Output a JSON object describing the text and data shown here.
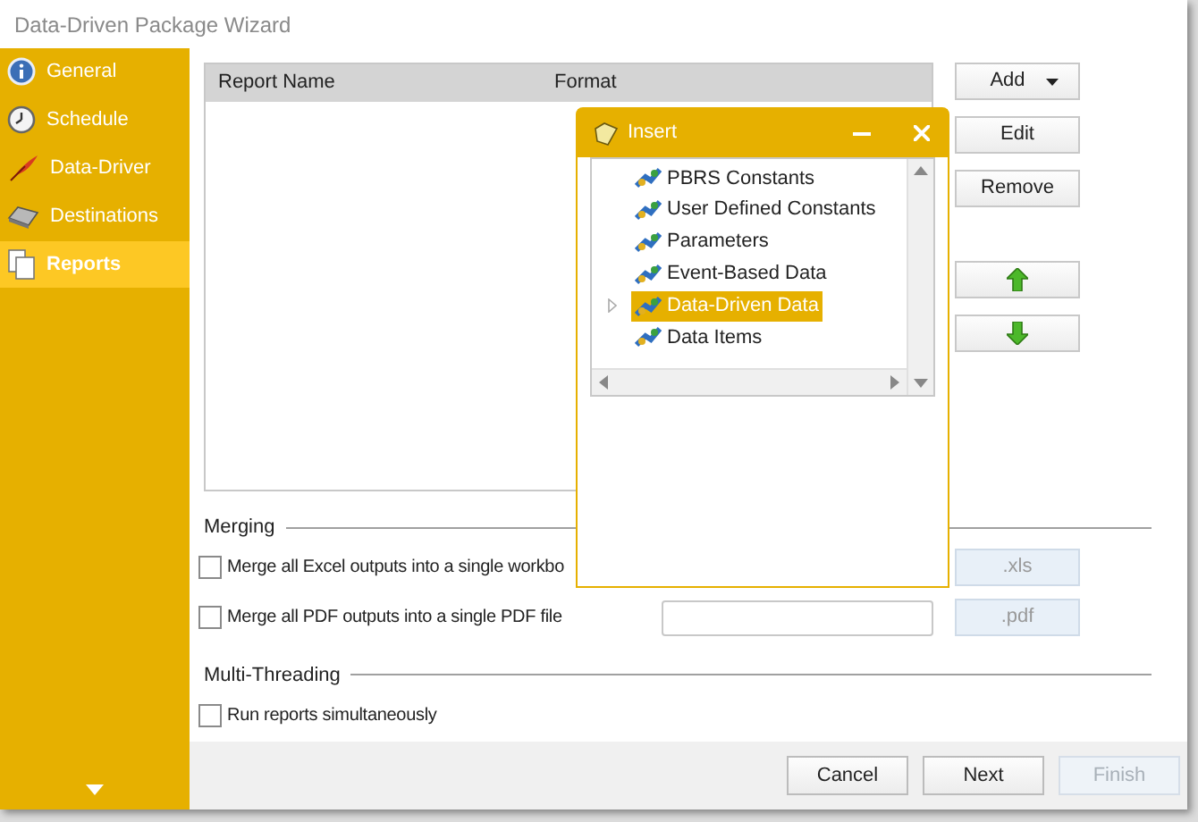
{
  "window": {
    "title": "Data-Driven Package Wizard"
  },
  "sidebar": {
    "items": [
      {
        "label": "General",
        "kind": "info",
        "selected": false
      },
      {
        "label": "Schedule",
        "kind": "clock",
        "selected": false
      },
      {
        "label": "Data-Driver",
        "kind": "feather",
        "selected": false
      },
      {
        "label": "Destinations",
        "kind": "drive",
        "selected": false
      },
      {
        "label": "Reports",
        "kind": "pages",
        "selected": true
      }
    ]
  },
  "reports_table": {
    "columns": [
      "Report Name",
      "Format"
    ]
  },
  "side_buttons": [
    {
      "kind": "dropdown",
      "label": "Add"
    },
    {
      "kind": "text",
      "label": "Edit"
    },
    {
      "kind": "text",
      "label": "Remove"
    },
    {
      "kind": "up"
    },
    {
      "kind": "down"
    }
  ],
  "merging": {
    "title": "Merging",
    "options": [
      {
        "label": "Merge all Excel outputs into a single workbo",
        "checked": false,
        "field_visible": false,
        "extension": ".xls"
      },
      {
        "label": "Merge all PDF outputs into a single PDF file",
        "checked": false,
        "field_visible": true,
        "extension": ".pdf"
      }
    ]
  },
  "multi_threading": {
    "title": "Multi-Threading",
    "options": [
      {
        "label": "Run reports simultaneously",
        "checked": false
      }
    ]
  },
  "footer": {
    "buttons": [
      {
        "label": "Cancel",
        "disabled": false
      },
      {
        "label": "Next",
        "disabled": false
      },
      {
        "label": "Finish",
        "disabled": true
      }
    ]
  },
  "insert_dialog": {
    "title": "Insert",
    "items": [
      {
        "label": "PBRS Constants",
        "selected": false,
        "expandable": false
      },
      {
        "label": "User Defined Constants",
        "selected": false,
        "expandable": false
      },
      {
        "label": "Parameters",
        "selected": false,
        "expandable": false
      },
      {
        "label": "Event-Based Data",
        "selected": false,
        "expandable": false
      },
      {
        "label": "Data-Driven Data",
        "selected": true,
        "expandable": true
      },
      {
        "label": "Data Items",
        "selected": false,
        "expandable": false
      }
    ]
  }
}
